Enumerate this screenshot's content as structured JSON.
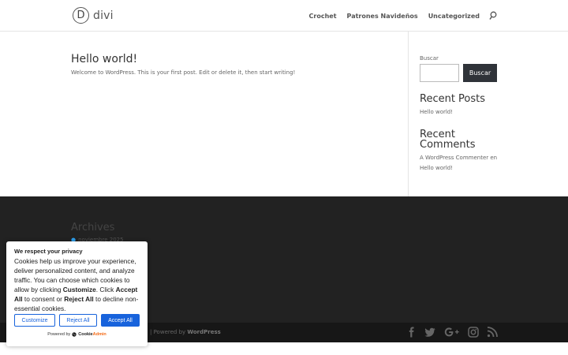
{
  "header": {
    "logo_mark": "D",
    "logo_text": "divi",
    "nav": [
      "Crochet",
      "Patrones Navideños",
      "Uncategorized"
    ]
  },
  "post": {
    "title": "Hello world!",
    "excerpt": "Welcome to WordPress. This is your first post. Edit or delete it, then start writing!"
  },
  "sidebar": {
    "search_label": "Buscar",
    "search_value": "",
    "search_button": "Buscar",
    "recent_posts_title": "Recent Posts",
    "recent_posts": [
      "Hello world!"
    ],
    "recent_comments_title_line1": "Recent",
    "recent_comments_title_line2": "Comments",
    "comment_author": "A WordPress Commenter",
    "comment_connector": "en",
    "comment_post": "Hello world!"
  },
  "footer": {
    "archives_title": "Archives",
    "archives": [
      "noviembre 2025"
    ],
    "credit_sep": "| Powered by ",
    "credit_link": "WordPress",
    "social_icons": [
      "facebook-icon",
      "twitter-icon",
      "google-plus-icon",
      "instagram-icon",
      "rss-icon"
    ]
  },
  "cookie": {
    "title": "We respect your privacy",
    "text_1": "Cookies help us improve your experience, deliver personalized content, and analyze traffic. You can choose which cookies to allow by clicking ",
    "text_customize": "Customize",
    "text_2": ". Click ",
    "text_accept": "Accept All",
    "text_3": " to consent or ",
    "text_reject": "Reject All",
    "text_4": " to decline non-essential cookies.",
    "btn_customize": "Customize",
    "btn_reject": "Reject All",
    "btn_accept": "Accept All",
    "powered_by": "Powered by",
    "brand_a": "Cookie",
    "brand_b": "Admin"
  },
  "colors": {
    "accent": "#1863dc",
    "footer_bg": "#222222",
    "button_dark": "#2f3339"
  }
}
